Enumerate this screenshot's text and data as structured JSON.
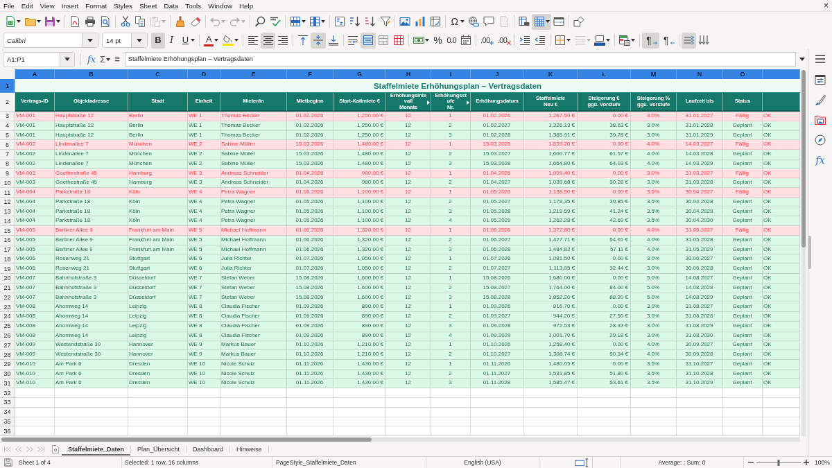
{
  "menu_bar": {
    "items": [
      "File",
      "Edit",
      "View",
      "Insert",
      "Format",
      "Styles",
      "Sheet",
      "Data",
      "Tools",
      "Window",
      "Help"
    ],
    "close_document": "×"
  },
  "toolbar_standard": {
    "groups": [
      [
        {
          "kind": "new",
          "on": false,
          "disabled": false
        },
        {
          "kind": "open",
          "on": false,
          "disabled": false
        },
        {
          "kind": "save",
          "on": false,
          "disabled": false
        }
      ],
      [
        {
          "kind": "export-pdf",
          "on": false,
          "disabled": false
        },
        {
          "kind": "print",
          "on": false,
          "disabled": false
        },
        {
          "kind": "print-preview",
          "on": false,
          "disabled": false
        }
      ],
      [
        {
          "kind": "cut",
          "on": false,
          "disabled": false
        },
        {
          "kind": "copy",
          "on": false,
          "disabled": false
        },
        {
          "kind": "paste",
          "on": false,
          "disabled": true
        }
      ],
      [
        {
          "kind": "clone-formatting",
          "on": false,
          "disabled": false
        },
        {
          "kind": "clear-formatting",
          "on": false,
          "disabled": false
        }
      ],
      [
        {
          "kind": "undo",
          "on": false,
          "disabled": true
        },
        {
          "kind": "redo",
          "on": false,
          "disabled": true
        }
      ],
      [
        {
          "kind": "find-replace",
          "on": false,
          "disabled": false
        },
        {
          "kind": "spelling",
          "on": false,
          "disabled": false
        }
      ],
      [
        {
          "kind": "row",
          "on": false,
          "disabled": false
        },
        {
          "kind": "column",
          "on": false,
          "disabled": false
        }
      ],
      [
        {
          "kind": "sort",
          "on": false,
          "disabled": false
        },
        {
          "kind": "sort-ascending",
          "on": false,
          "disabled": false
        },
        {
          "kind": "sort-descending",
          "on": false,
          "disabled": false
        },
        {
          "kind": "autofilter",
          "on": false,
          "disabled": false
        }
      ],
      [
        {
          "kind": "image",
          "on": false,
          "disabled": false
        },
        {
          "kind": "chart",
          "on": false,
          "disabled": false
        },
        {
          "kind": "pivot-table",
          "on": false,
          "disabled": false
        }
      ],
      [
        {
          "kind": "special-character",
          "label": "Ω",
          "on": false,
          "disabled": false
        },
        {
          "kind": "hyperlink",
          "on": false,
          "disabled": false
        },
        {
          "kind": "comment",
          "on": false,
          "disabled": false
        },
        {
          "kind": "headers-footers",
          "on": false,
          "disabled": true
        }
      ],
      [
        {
          "kind": "print-area",
          "on": false,
          "disabled": false
        },
        {
          "kind": "freeze",
          "on": true,
          "disabled": false
        },
        {
          "kind": "split-window",
          "on": false,
          "disabled": false
        }
      ],
      [
        {
          "kind": "draw-functions",
          "on": false,
          "disabled": false
        }
      ]
    ]
  },
  "toolbar_formatting": {
    "font_name": "Calibri",
    "font_size": "14 pt",
    "groups": [
      [
        {
          "kind": "bold",
          "label": "B",
          "on": true,
          "disabled": false
        },
        {
          "kind": "italic",
          "label": "I",
          "on": false,
          "disabled": false
        },
        {
          "kind": "underline",
          "label": "U",
          "on": false,
          "disabled": false
        }
      ],
      [
        {
          "kind": "font-color",
          "label": "A",
          "on": false,
          "disabled": false
        },
        {
          "kind": "highlighting",
          "on": false,
          "disabled": false
        }
      ],
      [
        {
          "kind": "align-left",
          "on": false,
          "disabled": false
        },
        {
          "kind": "align-center",
          "on": true,
          "disabled": false
        },
        {
          "kind": "align-right",
          "on": false,
          "disabled": false
        }
      ],
      [
        {
          "kind": "align-top",
          "on": false,
          "disabled": false
        },
        {
          "kind": "align-middle",
          "on": true,
          "disabled": false
        },
        {
          "kind": "align-bottom",
          "on": false,
          "disabled": false
        }
      ],
      [
        {
          "kind": "wrap-text",
          "on": false,
          "disabled": false
        },
        {
          "kind": "merge-center",
          "on": true,
          "disabled": false
        },
        {
          "kind": "merge-cells",
          "on": false,
          "disabled": false
        },
        {
          "kind": "unmerge-cells",
          "on": false,
          "disabled": false
        }
      ],
      [
        {
          "kind": "currency",
          "on": false,
          "disabled": false
        },
        {
          "kind": "percent",
          "label": "%",
          "on": false,
          "disabled": false
        },
        {
          "kind": "number",
          "label": "0.0",
          "on": false,
          "disabled": false
        },
        {
          "kind": "date",
          "on": false,
          "disabled": false
        }
      ],
      [
        {
          "kind": "add-decimal",
          "label": ".00",
          "on": false,
          "disabled": false
        },
        {
          "kind": "delete-decimal",
          "label": ".00",
          "on": false,
          "disabled": false
        }
      ],
      [
        {
          "kind": "increase-indent",
          "on": false,
          "disabled": false
        },
        {
          "kind": "decrease-indent",
          "on": false,
          "disabled": false
        }
      ],
      [
        {
          "kind": "borders",
          "on": false,
          "disabled": false
        },
        {
          "kind": "border-style",
          "on": false,
          "disabled": true
        },
        {
          "kind": "border-color",
          "on": false,
          "disabled": false
        }
      ],
      [
        {
          "kind": "conditional",
          "on": false,
          "disabled": false
        }
      ],
      [
        {
          "kind": "paragraph-ltr",
          "label": "¶",
          "on": true,
          "disabled": false
        },
        {
          "kind": "paragraph-rtl",
          "label": "¶",
          "on": false,
          "disabled": false
        }
      ],
      [
        {
          "kind": "text-ltr",
          "on": true,
          "disabled": false
        },
        {
          "kind": "text-ttb",
          "on": false,
          "disabled": false
        }
      ]
    ]
  },
  "formula_bar": {
    "name_box": "A1:P1",
    "buttons": [
      {
        "kind": "function-wizard",
        "label": "fx"
      },
      {
        "kind": "sum",
        "label": "Σ"
      },
      {
        "kind": "formula",
        "label": "="
      }
    ],
    "content": "Staffelmiete Erhöhungsplan – Vertragsdaten"
  },
  "sidebar": {
    "items": [
      {
        "kind": "properties"
      },
      {
        "kind": "styles"
      },
      {
        "kind": "gallery"
      },
      {
        "kind": "navigator"
      },
      {
        "kind": "functions",
        "label": "fx"
      }
    ]
  },
  "sheet": {
    "columns": [
      {
        "letter": "A",
        "selected": true
      },
      {
        "letter": "B",
        "selected": true
      },
      {
        "letter": "C",
        "selected": true
      },
      {
        "letter": "D",
        "selected": true
      },
      {
        "letter": "E",
        "selected": true
      },
      {
        "letter": "F",
        "selected": true
      },
      {
        "letter": "G",
        "selected": true
      },
      {
        "letter": "H",
        "selected": true
      },
      {
        "letter": "I",
        "selected": true
      },
      {
        "letter": "J",
        "selected": true
      },
      {
        "letter": "K",
        "selected": true
      },
      {
        "letter": "L",
        "selected": true
      },
      {
        "letter": "M",
        "selected": true
      },
      {
        "letter": "N",
        "selected": true
      },
      {
        "letter": "O",
        "selected": true
      },
      {
        "selected": true
      }
    ],
    "title_row": {
      "number": "1",
      "selected": true,
      "text": "Staffelmiete Erhöhungsplan – Vertragsdaten"
    },
    "header_row": {
      "number": "2",
      "selected": false,
      "cells": [
        {
          "text": "Vertrags-ID",
          "clipped": false
        },
        {
          "text": "Objektadresse",
          "clipped": false
        },
        {
          "text": "Stadt",
          "clipped": false
        },
        {
          "text": "Einheit",
          "clipped": false
        },
        {
          "text": "Mieter/in",
          "clipped": false
        },
        {
          "text": "Mietbeginn",
          "clipped": false
        },
        {
          "text": "Start-Kaltmiete €",
          "clipped": false
        },
        {
          "text": "Erhöhungsinte\nvall\nMonate",
          "clipped": true
        },
        {
          "text": "Erhöhungsst\nufe\nNr.",
          "clipped": true
        },
        {
          "text": "Erhöhungsdatum",
          "clipped": false
        },
        {
          "text": "Staffelmiete\nNeu €",
          "clipped": false
        },
        {
          "text": "Steigerung €\nggü. Vorstufe",
          "clipped": false
        },
        {
          "text": "Steigerung %\nggü. Vorstufe",
          "clipped": false
        },
        {
          "text": "Laufzeit bis",
          "clipped": false
        },
        {
          "text": "Status",
          "clipped": false
        }
      ]
    },
    "rows": [
      {
        "number": "3",
        "selected": false,
        "highlighted": true,
        "cells": [
          "VM-001",
          "Hauptstraße 12",
          "Berlin",
          "WE 1",
          "Thomas Becker",
          "01.02.2026",
          "1,250.00 €",
          "12",
          "1",
          "01.02.2026",
          "1,287.50 €",
          "0.00 €",
          "3.0%",
          "31.01.2027",
          "Fällig",
          "OK"
        ]
      },
      {
        "number": "4",
        "selected": false,
        "highlighted": false,
        "cells": [
          "VM-001",
          "Hauptstraße 12",
          "Berlin",
          "WE 1",
          "Thomas Becker",
          "01.02.2026",
          "1,250.00 €",
          "12",
          "2",
          "01.02.2027",
          "1,326.13 €",
          "38.63 €",
          "3.0%",
          "31.01.2028",
          "Geplant",
          "OK"
        ]
      },
      {
        "number": "5",
        "selected": false,
        "highlighted": false,
        "cells": [
          "VM-001",
          "Hauptstraße 12",
          "Berlin",
          "WE 1",
          "Thomas Becker",
          "01.02.2026",
          "1,250.00 €",
          "12",
          "3",
          "01.02.2028",
          "1,365.91 €",
          "39.78 €",
          "3.0%",
          "31.01.2029",
          "Geplant",
          "OK"
        ]
      },
      {
        "number": "6",
        "selected": false,
        "highlighted": true,
        "cells": [
          "VM-002",
          "Lindenallee 7",
          "München",
          "WE 2",
          "Sabine Müller",
          "15.03.2026",
          "1,480.00 €",
          "12",
          "1",
          "15.03.2026",
          "1,539.20 €",
          "0.00 €",
          "4.0%",
          "14.03.2027",
          "Fällig",
          "OK"
        ]
      },
      {
        "number": "7",
        "selected": false,
        "highlighted": false,
        "cells": [
          "VM-002",
          "Lindenallee 7",
          "München",
          "WE 2",
          "Sabine Müller",
          "15.03.2026",
          "1,480.00 €",
          "12",
          "2",
          "15.03.2027",
          "1,600.77 €",
          "61.57 €",
          "4.0%",
          "14.03.2028",
          "Geplant",
          "OK"
        ]
      },
      {
        "number": "8",
        "selected": false,
        "highlighted": false,
        "cells": [
          "VM-002",
          "Lindenallee 7",
          "München",
          "WE 2",
          "Sabine Müller",
          "15.03.2026",
          "1,480.00 €",
          "12",
          "3",
          "15.03.2028",
          "1,664.80 €",
          "64.03 €",
          "4.0%",
          "14.03.2029",
          "Geplant",
          "OK"
        ]
      },
      {
        "number": "9",
        "selected": false,
        "highlighted": true,
        "cells": [
          "VM-003",
          "Goethestraße 45",
          "Hamburg",
          "WE 3",
          "Andreas Schneider",
          "01.04.2026",
          "980.00 €",
          "12",
          "1",
          "01.04.2026",
          "1,009.40 €",
          "0.00 €",
          "3.0%",
          "31.03.2027",
          "Fällig",
          "OK"
        ]
      },
      {
        "number": "10",
        "selected": false,
        "highlighted": false,
        "cells": [
          "VM-003",
          "Goethestraße 45",
          "Hamburg",
          "WE 3",
          "Andreas Schneider",
          "01.04.2026",
          "980.00 €",
          "12",
          "2",
          "01.04.2027",
          "1,039.68 €",
          "30.28 €",
          "3.0%",
          "31.03.2028",
          "Geplant",
          "OK"
        ]
      },
      {
        "number": "11",
        "selected": false,
        "highlighted": true,
        "cells": [
          "VM-004",
          "Parkstraße 18",
          "Köln",
          "WE 4",
          "Petra Wagner",
          "01.05.2026",
          "1,100.00 €",
          "12",
          "1",
          "01.05.2026",
          "1,138.50 €",
          "0.00 €",
          "3.5%",
          "30.04.2027",
          "Fällig",
          "OK"
        ]
      },
      {
        "number": "12",
        "selected": false,
        "highlighted": false,
        "cells": [
          "VM-004",
          "Parkstraße 18",
          "Köln",
          "WE 4",
          "Petra Wagner",
          "01.05.2026",
          "1,100.00 €",
          "12",
          "2",
          "01.05.2027",
          "1,178.35 €",
          "39.85 €",
          "3.5%",
          "30.04.2028",
          "Geplant",
          "OK"
        ]
      },
      {
        "number": "13",
        "selected": false,
        "highlighted": false,
        "cells": [
          "VM-004",
          "Parkstraße 18",
          "Köln",
          "WE 4",
          "Petra Wagner",
          "01.05.2026",
          "1,100.00 €",
          "12",
          "3",
          "01.05.2028",
          "1,219.59 €",
          "41.24 €",
          "3.5%",
          "30.04.2029",
          "Geplant",
          "OK"
        ]
      },
      {
        "number": "14",
        "selected": false,
        "highlighted": false,
        "cells": [
          "VM-004",
          "Parkstraße 18",
          "Köln",
          "WE 4",
          "Petra Wagner",
          "01.05.2026",
          "1,100.00 €",
          "12",
          "4",
          "01.05.2029",
          "1,262.28 €",
          "42.69 €",
          "3.5%",
          "30.04.2030",
          "Geplant",
          "OK"
        ]
      },
      {
        "number": "15",
        "selected": false,
        "highlighted": true,
        "cells": [
          "VM-005",
          "Berliner Allee 9",
          "Frankfurt am Main",
          "WE 5",
          "Michael Hoffmann",
          "01.06.2026",
          "1,320.00 €",
          "12",
          "1",
          "01.06.2026",
          "1,372.80 €",
          "0.00 €",
          "4.0%",
          "31.05.2027",
          "Fällig",
          "OK"
        ]
      },
      {
        "number": "16",
        "selected": false,
        "highlighted": false,
        "cells": [
          "VM-005",
          "Berliner Allee 9",
          "Frankfurt am Main",
          "WE 5",
          "Michael Hoffmann",
          "01.06.2026",
          "1,320.00 €",
          "12",
          "2",
          "01.06.2027",
          "1,427.71 €",
          "54.91 €",
          "4.0%",
          "31.05.2028",
          "Geplant",
          "OK"
        ]
      },
      {
        "number": "17",
        "selected": false,
        "highlighted": false,
        "cells": [
          "VM-005",
          "Berliner Allee 9",
          "Frankfurt am Main",
          "WE 5",
          "Michael Hoffmann",
          "01.06.2026",
          "1,320.00 €",
          "12",
          "3",
          "01.06.2028",
          "1,484.82 €",
          "57.11 €",
          "4.0%",
          "31.05.2029",
          "Geplant",
          "OK"
        ]
      },
      {
        "number": "18",
        "selected": false,
        "highlighted": false,
        "cells": [
          "VM-006",
          "Rosenweg 21",
          "Stuttgart",
          "WE 6",
          "Julia Richter",
          "01.07.2026",
          "1,050.00 €",
          "12",
          "1",
          "01.07.2026",
          "1,081.50 €",
          "0.00 €",
          "3.0%",
          "30.06.2027",
          "Geplant",
          "OK"
        ]
      },
      {
        "number": "19",
        "selected": false,
        "highlighted": false,
        "cells": [
          "VM-006",
          "Rosenweg 21",
          "Stuttgart",
          "WE 6",
          "Julia Richter",
          "01.07.2026",
          "1,050.00 €",
          "12",
          "2",
          "01.07.2027",
          "1,113.95 €",
          "32.44 €",
          "3.0%",
          "30.06.2028",
          "Geplant",
          "OK"
        ]
      },
      {
        "number": "20",
        "selected": false,
        "highlighted": false,
        "cells": [
          "VM-007",
          "Bahnhofstraße 3",
          "Düsseldorf",
          "WE 7",
          "Stefan Weber",
          "15.08.2026",
          "1,600.00 €",
          "12",
          "1",
          "15.08.2026",
          "1,680.00 €",
          "0.00 €",
          "5.0%",
          "14.08.2027",
          "Geplant",
          "OK"
        ]
      },
      {
        "number": "21",
        "selected": false,
        "highlighted": false,
        "cells": [
          "VM-007",
          "Bahnhofstraße 3",
          "Düsseldorf",
          "WE 7",
          "Stefan Weber",
          "15.08.2026",
          "1,600.00 €",
          "12",
          "2",
          "15.08.2027",
          "1,764.00 €",
          "84.00 €",
          "5.0%",
          "14.08.2028",
          "Geplant",
          "OK"
        ]
      },
      {
        "number": "22",
        "selected": false,
        "highlighted": false,
        "cells": [
          "VM-007",
          "Bahnhofstraße 3",
          "Düsseldorf",
          "WE 7",
          "Stefan Weber",
          "15.08.2026",
          "1,600.00 €",
          "12",
          "3",
          "15.08.2028",
          "1,852.20 €",
          "88.20 €",
          "5.0%",
          "14.08.2029",
          "Geplant",
          "OK"
        ]
      },
      {
        "number": "23",
        "selected": false,
        "highlighted": false,
        "cells": [
          "VM-008",
          "Ahornweg 14",
          "Leipzig",
          "WE 8",
          "Claudia Fischer",
          "01.09.2026",
          "890.00 €",
          "12",
          "1",
          "01.09.2026",
          "916.70 €",
          "0.00 €",
          "3.0%",
          "31.08.2027",
          "Geplant",
          "OK"
        ]
      },
      {
        "number": "24",
        "selected": false,
        "highlighted": false,
        "cells": [
          "VM-008",
          "Ahornweg 14",
          "Leipzig",
          "WE 8",
          "Claudia Fischer",
          "01.09.2026",
          "890.00 €",
          "12",
          "2",
          "01.09.2027",
          "944.20 €",
          "27.50 €",
          "3.0%",
          "31.08.2028",
          "Geplant",
          "OK"
        ]
      },
      {
        "number": "25",
        "selected": false,
        "highlighted": false,
        "cells": [
          "VM-008",
          "Ahornweg 14",
          "Leipzig",
          "WE 8",
          "Claudia Fischer",
          "01.09.2026",
          "890.00 €",
          "12",
          "3",
          "01.09.2028",
          "972.53 €",
          "28.33 €",
          "3.0%",
          "31.08.2029",
          "Geplant",
          "OK"
        ]
      },
      {
        "number": "26",
        "selected": false,
        "highlighted": false,
        "cells": [
          "VM-008",
          "Ahornweg 14",
          "Leipzig",
          "WE 8",
          "Claudia Fischer",
          "01.09.2026",
          "890.00 €",
          "12",
          "4",
          "01.09.2029",
          "1,001.70 €",
          "29.18 €",
          "3.0%",
          "31.08.2030",
          "Geplant",
          "OK"
        ]
      },
      {
        "number": "27",
        "selected": false,
        "highlighted": false,
        "cells": [
          "VM-009",
          "Westendstraße 30",
          "Hannover",
          "WE 9",
          "Markus Bauer",
          "01.10.2026",
          "1,210.00 €",
          "12",
          "1",
          "01.10.2026",
          "1,258.40 €",
          "0.00 €",
          "4.0%",
          "30.09.2027",
          "Geplant",
          "OK"
        ]
      },
      {
        "number": "28",
        "selected": false,
        "highlighted": false,
        "cells": [
          "VM-009",
          "Westendstraße 30",
          "Hannover",
          "WE 9",
          "Markus Bauer",
          "01.10.2026",
          "1,210.00 €",
          "12",
          "2",
          "01.10.2027",
          "1,308.74 €",
          "50.34 €",
          "4.0%",
          "30.09.2028",
          "Geplant",
          "OK"
        ]
      },
      {
        "number": "29",
        "selected": false,
        "highlighted": false,
        "cells": [
          "VM-010",
          "Am Park 6",
          "Dresden",
          "WE 10",
          "Nicole Schulz",
          "01.11.2026",
          "1,430.00 €",
          "12",
          "1",
          "01.11.2026",
          "1,480.05 €",
          "0.00 €",
          "3.5%",
          "31.10.2027",
          "Geplant",
          "OK"
        ]
      },
      {
        "number": "30",
        "selected": false,
        "highlighted": false,
        "cells": [
          "VM-010",
          "Am Park 6",
          "Dresden",
          "WE 10",
          "Nicole Schulz",
          "01.11.2026",
          "1,430.00 €",
          "12",
          "2",
          "01.11.2027",
          "1,531.85 €",
          "51.80 €",
          "3.5%",
          "31.10.2028",
          "Geplant",
          "OK"
        ]
      },
      {
        "number": "31",
        "selected": false,
        "highlighted": false,
        "cells": [
          "VM-010",
          "Am Park 6",
          "Dresden",
          "WE 10",
          "Nicole Schulz",
          "01.11.2026",
          "1,430.00 €",
          "12",
          "3",
          "01.11.2028",
          "1,585.47 €",
          "53.61 €",
          "3.5%",
          "31.10.2029",
          "Geplant",
          "OK"
        ]
      }
    ],
    "empty_rows": [
      {
        "number": "32",
        "selected": false
      },
      {
        "number": "33",
        "selected": false
      },
      {
        "number": "34",
        "selected": false
      },
      {
        "number": "35",
        "selected": false
      },
      {
        "number": "36",
        "selected": false
      }
    ]
  },
  "sheet_tabs": {
    "navigation": [
      {
        "kind": "first",
        "disabled": true
      },
      {
        "kind": "previous",
        "disabled": true
      },
      {
        "kind": "next",
        "disabled": true
      },
      {
        "kind": "last",
        "disabled": true
      }
    ],
    "tabs": [
      {
        "label": "Staffelmiete_Daten",
        "selected": true
      },
      {
        "label": "Plan_Übersicht",
        "selected": false
      },
      {
        "label": "Dashboard",
        "selected": false
      },
      {
        "label": "Hinweise",
        "selected": false
      }
    ]
  },
  "status_bar": {
    "sheet": "Sheet 1 of 4",
    "selection": "Selected: 1 row, 16 columns",
    "page_style": "PageStyle_Staffelmiete_Daten",
    "language": "English (USA)",
    "summary": "Average: ; Sum: 0",
    "zoom": {
      "level": 0.5,
      "reading": "100%"
    }
  }
}
